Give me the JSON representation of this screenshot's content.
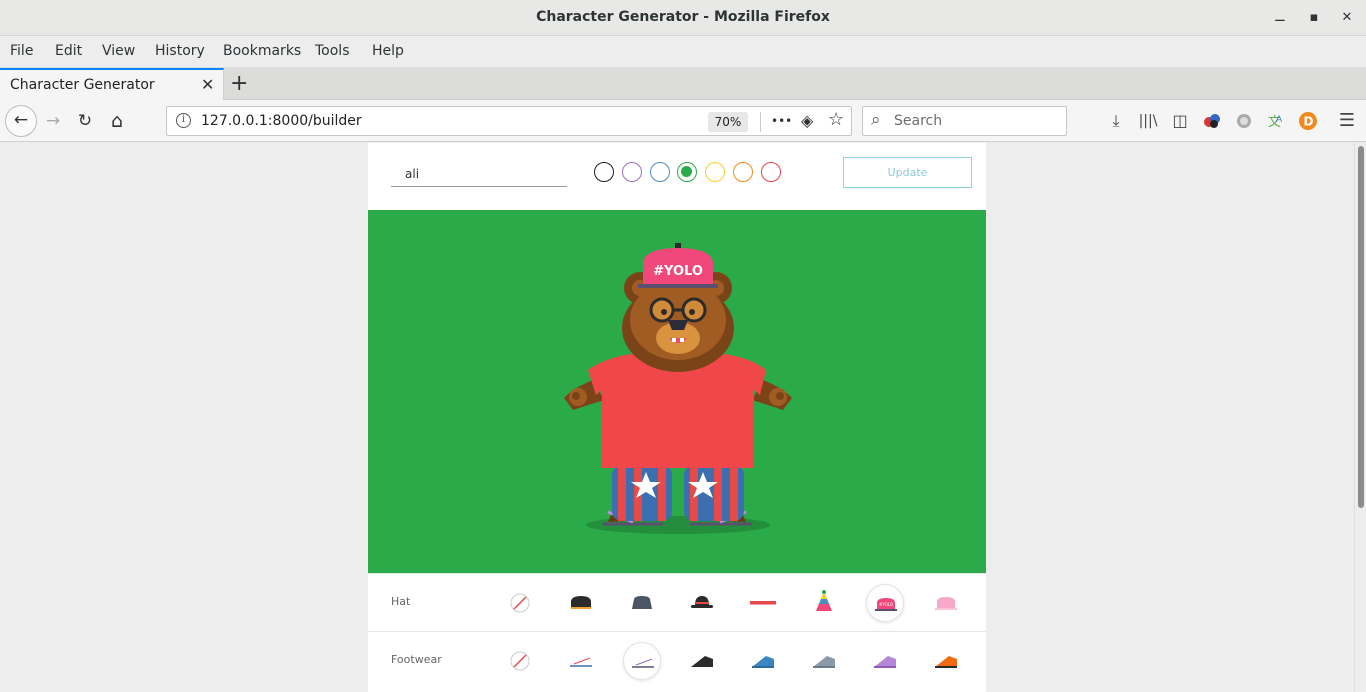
{
  "window": {
    "title": "Character Generator - Mozilla Firefox",
    "min": "⚊",
    "max": "▪",
    "close": "✕"
  },
  "menu": [
    "File",
    "Edit",
    "View",
    "History",
    "Bookmarks",
    "Tools",
    "Help"
  ],
  "tab": {
    "label": "Character Generator",
    "close": "✕",
    "new": "+"
  },
  "nav": {
    "back": "←",
    "forward": "→",
    "reload": "↻",
    "home": "⌂",
    "url": "127.0.0.1:8000/builder",
    "zoom": "70%",
    "more": "•••",
    "pocket": "◈",
    "star": "☆",
    "search_placeholder": "Search"
  },
  "toolbar_icons": [
    "download-icon",
    "library-icon",
    "sidebar-icon",
    "extension-icon",
    "circle-icon",
    "translate-icon",
    "addon-icon",
    "menu-icon"
  ],
  "builder": {
    "name_value": "ali",
    "update_label": "Update",
    "colors": [
      {
        "name": "black",
        "hex": "#222222",
        "selected": false
      },
      {
        "name": "purple",
        "hex": "#9b6fc0",
        "selected": false
      },
      {
        "name": "blue",
        "hex": "#4a8fc0",
        "selected": false
      },
      {
        "name": "green",
        "hex": "#2aaa48",
        "selected": true
      },
      {
        "name": "yellow",
        "hex": "#f5cf2a",
        "selected": false
      },
      {
        "name": "orange",
        "hex": "#f08a1e",
        "selected": false
      },
      {
        "name": "red",
        "hex": "#e8434a",
        "selected": false
      }
    ],
    "stage_color": "#2aaa48",
    "hat_text": "#YOLO",
    "rows": [
      {
        "label": "Hat",
        "selected": 6,
        "options": [
          "none-icon",
          "beanie-dark-icon",
          "cap-gray-icon",
          "bowler-icon",
          "headband-icon",
          "party-hat-icon",
          "yolo-cap-icon",
          "pink-cap-icon"
        ]
      },
      {
        "label": "Footwear",
        "selected": 2,
        "options": [
          "none-icon",
          "flip-flop-icon",
          "sandal-icon",
          "dark-shoe-icon",
          "blue-shoe-icon",
          "gray-shoe-icon",
          "purple-shoe-icon",
          "orange-shoe-icon"
        ]
      }
    ]
  }
}
